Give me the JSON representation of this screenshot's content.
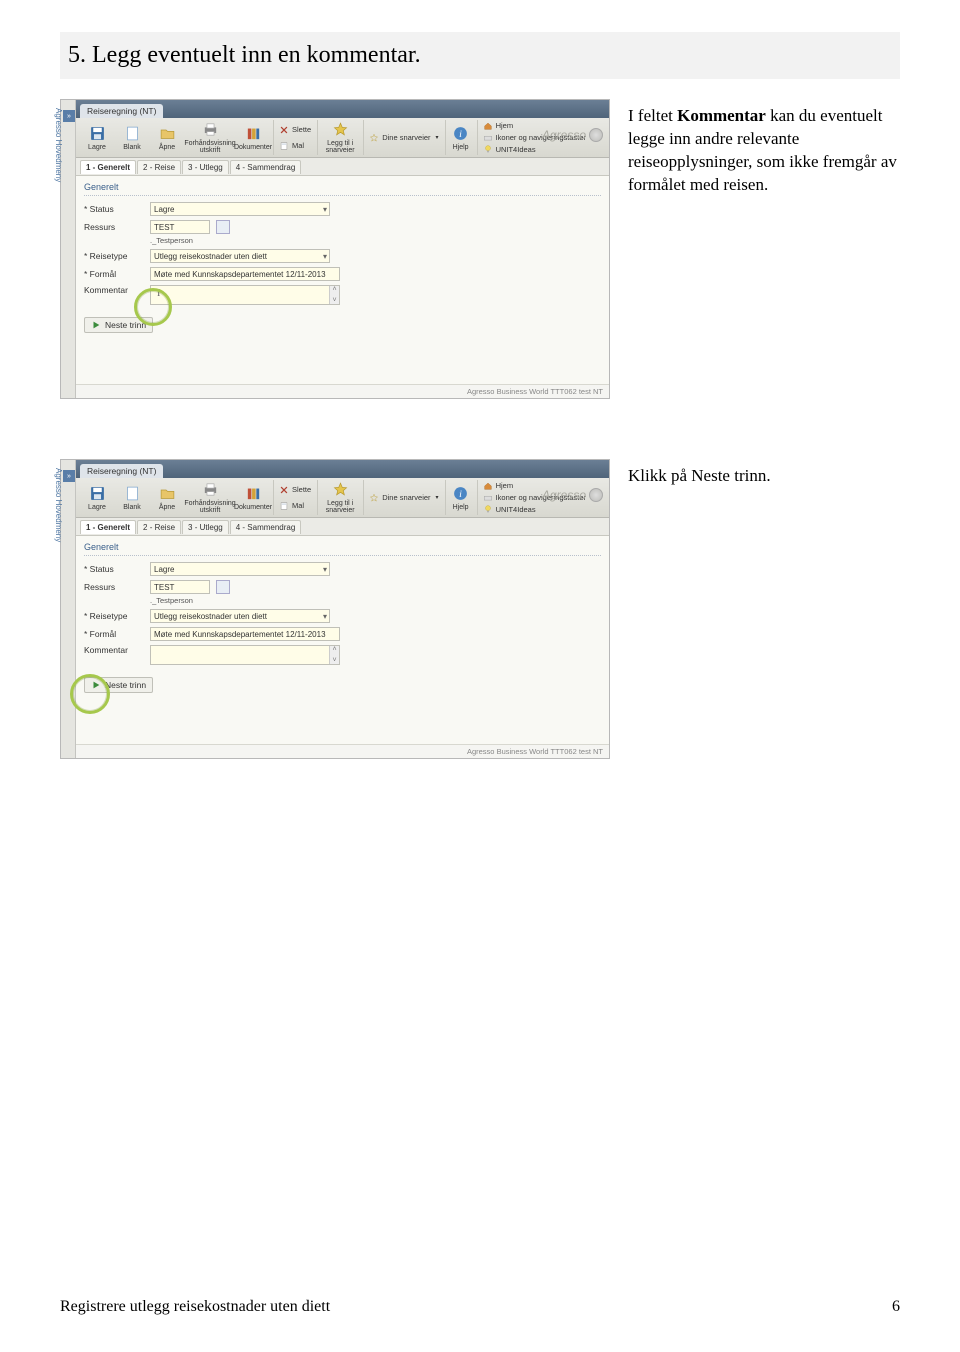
{
  "heading": "5. Legg eventuelt inn en kommentar.",
  "para1_pre": "I feltet ",
  "para1_bold": "Kommentar",
  "para1_post": " kan du eventuelt legge inn andre relevante reiseopplysninger, som ikke fremgår av formålet med reisen.",
  "para2": "Klikk på Neste trinn.",
  "footer_left": "Registrere utlegg reisekostnader uten diett",
  "footer_right": "6",
  "shot": {
    "side_label": "Agresso Hovedmeny",
    "tab_title": "Reiseregning (NT)",
    "toolbar": {
      "lagre": "Lagre",
      "blank": "Blank",
      "apne": "Åpne",
      "forhands": "Forhåndsvisning utskrift",
      "dokumenter": "Dokumenter",
      "slette": "Slette",
      "mal": "Mal",
      "leggtil": "Legg til i snarveier",
      "dine": "Dine snarveier",
      "hjelp": "Hjelp",
      "hjem": "Hjem",
      "ikoner": "Ikoner og navigeringstaster",
      "unit4": "UNIT4Ideas"
    },
    "brand": "Agresso",
    "subtabs": {
      "t1": "1 - Generelt",
      "t2": "2 - Reise",
      "t3": "3 - Utlegg",
      "t4": "4 - Sammendrag"
    },
    "legend": "Generelt",
    "labels": {
      "status": "* Status",
      "ressurs": "Ressurs",
      "reisetype": "* Reisetype",
      "formal": "* Formål",
      "kommentar": "Kommentar"
    },
    "values": {
      "status": "Lagre",
      "ressurs": "TEST",
      "ressurs_sub": "._Testperson",
      "reisetype": "Utlegg reisekostnader uten diett",
      "formal": "Møte med Kunnskapsdepartementet 12/11-2013"
    },
    "neste": "Neste trinn",
    "status_line": "Agresso Business World  TTT062  test  NT"
  }
}
